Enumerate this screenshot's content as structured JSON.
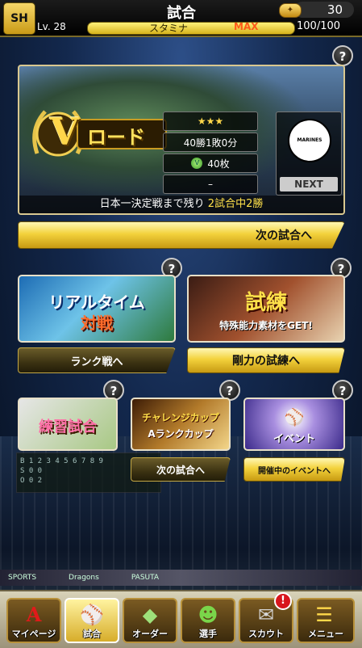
{
  "header": {
    "logo_text": "SH",
    "title": "試合",
    "coin_icon": "gold-ticket-icon",
    "coin_count": "30",
    "level": "Lv. 28",
    "stamina_label": "スタミナ",
    "stamina_max_label": "MAX",
    "stamina_value": "100/100",
    "stamina_fill": 1.0
  },
  "vroad": {
    "v_letter": "V",
    "title": "ロード",
    "stars": "★★★",
    "record": "40勝1敗0分",
    "medals": "40枚",
    "dash": "–",
    "opponent_logo_text": "MARINES CHIBA LOTTE",
    "next_label": "NEXT",
    "remaining_prefix": "日本一決定戦まで残り",
    "remaining_highlight": "2試合中2勝"
  },
  "buttons": {
    "next_match": "次の試合へ",
    "ranked": "ランク戦へ",
    "training": "剛力の試練へ",
    "challenge_next": "次の試合へ",
    "event_ongoing": "開催中のイベントへ"
  },
  "cards": {
    "realtime_line1": "リアルタイム",
    "realtime_line2": "対戦",
    "trial_title": "試練",
    "trial_sub": "特殊能力素材をGET!",
    "practice": "練習試合",
    "challenge_line1": "チャレンジカップ",
    "challenge_line2": "Aランクカップ",
    "event": "イベント"
  },
  "help_icon": "?",
  "background": {
    "scoreboard_line1": "B 1 2 3 4 5 6 7 8 9",
    "scoreboard_line2": "S 0 0",
    "scoreboard_line3": "O 0 2",
    "ad1": "SPORTS",
    "ad2": "Dragons",
    "ad3": "PASUTA"
  },
  "nav": {
    "items": [
      {
        "label": "マイページ",
        "icon": "mypage-a-icon"
      },
      {
        "label": "試合",
        "icon": "baseball-glove-icon"
      },
      {
        "label": "オーダー",
        "icon": "field-order-icon"
      },
      {
        "label": "選手",
        "icon": "player-icon"
      },
      {
        "label": "スカウト",
        "icon": "scout-ticket-icon"
      },
      {
        "label": "メニュー",
        "icon": "menu-icon"
      }
    ],
    "scout_badge": "!"
  }
}
